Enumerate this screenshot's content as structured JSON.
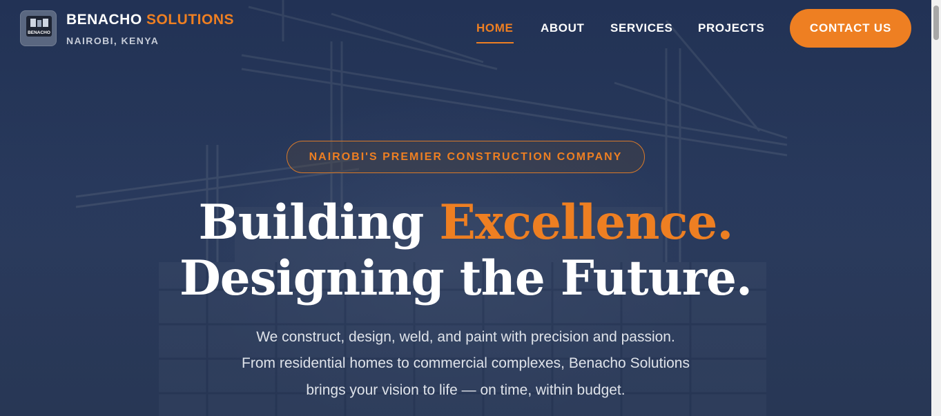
{
  "header": {
    "logo_text": "BENACHO",
    "brand_name_main": "BENACHO",
    "brand_name_accent": "SOLUTIONS",
    "location": "NAIROBI, KENYA"
  },
  "nav": {
    "items": [
      {
        "label": "HOME",
        "active": true
      },
      {
        "label": "ABOUT",
        "active": false
      },
      {
        "label": "SERVICES",
        "active": false
      },
      {
        "label": "PROJECTS",
        "active": false
      }
    ],
    "contact_label": "CONTACT US"
  },
  "hero": {
    "badge": "NAIROBI'S PREMIER CONSTRUCTION COMPANY",
    "headline_line1_main": "Building ",
    "headline_line1_accent": "Excellence.",
    "headline_line2": "Designing the Future.",
    "subtext_lines": [
      "We construct, design, weld, and paint with precision and passion.",
      "From residential homes to commercial complexes, Benacho Solutions",
      "brings your vision to life — on time, within budget."
    ]
  },
  "colors": {
    "accent": "#ee7f22",
    "background": "#2a3a57",
    "text": "#ffffff"
  }
}
